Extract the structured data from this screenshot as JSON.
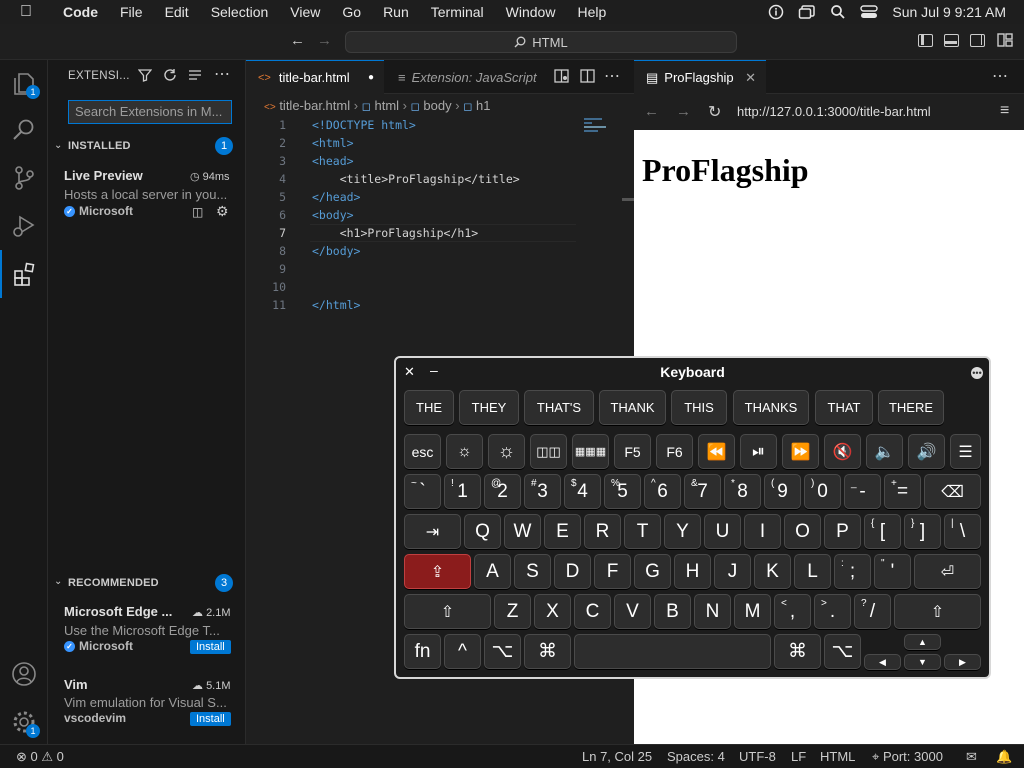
{
  "menubar": {
    "app": "Code",
    "items": [
      "File",
      "Edit",
      "Selection",
      "View",
      "Go",
      "Run",
      "Terminal",
      "Window",
      "Help"
    ],
    "datetime": "Sun Jul 9  9:21 AM"
  },
  "titlebar": {
    "command_center": "HTML"
  },
  "activity": {
    "explorer_badge": "1",
    "extensions_badge": "",
    "settings_badge": "1"
  },
  "sidebar": {
    "title": "EXTENSI...",
    "search_placeholder": "Search Extensions in M...",
    "installed": {
      "label": "INSTALLED",
      "count": "1",
      "items": [
        {
          "name": "Live Preview",
          "meta": "94ms",
          "desc": "Hosts a local server in you...",
          "publisher": "Microsoft"
        }
      ]
    },
    "recommended": {
      "label": "RECOMMENDED",
      "count": "3",
      "items": [
        {
          "name": "Microsoft Edge ...",
          "meta": "2.1M",
          "desc": "Use the Microsoft Edge T...",
          "publisher": "Microsoft",
          "action": "Install"
        },
        {
          "name": "Vim",
          "meta": "5.1M",
          "desc": "Vim emulation for Visual S...",
          "publisher": "vscodevim",
          "action": "Install"
        }
      ]
    }
  },
  "editor": {
    "tabs": [
      {
        "label": "title-bar.html",
        "active": true
      },
      {
        "label": "Extension: JavaScript",
        "active": false
      }
    ],
    "breadcrumb": [
      "title-bar.html",
      "html",
      "body",
      "h1"
    ],
    "lines": [
      {
        "n": "1",
        "text": "<!DOCTYPE html>"
      },
      {
        "n": "2",
        "text": "<html>"
      },
      {
        "n": "3",
        "text": "<head>"
      },
      {
        "n": "4",
        "text": "    <title>ProFlagship</title>"
      },
      {
        "n": "5",
        "text": "</head>"
      },
      {
        "n": "6",
        "text": "<body>"
      },
      {
        "n": "7",
        "text": "    <h1>ProFlagship</h1>"
      },
      {
        "n": "8",
        "text": "</body>"
      },
      {
        "n": "9",
        "text": ""
      },
      {
        "n": "10",
        "text": ""
      },
      {
        "n": "11",
        "text": "</html>"
      }
    ]
  },
  "browser": {
    "tab": "ProFlagship",
    "url": "http://127.0.0.1:3000/title-bar.html",
    "heading": "ProFlagship"
  },
  "status": {
    "errors": "0",
    "warnings": "0",
    "position": "Ln 7, Col 25",
    "spaces": "Spaces: 4",
    "encoding": "UTF-8",
    "eol": "LF",
    "language": "HTML",
    "port": "Port: 3000"
  },
  "keyboard": {
    "title": "Keyboard",
    "suggestions": [
      "THE",
      "THEY",
      "THAT'S",
      "THANK",
      "THIS",
      "THANKS",
      "THAT",
      "THERE"
    ],
    "fn_row": [
      "esc",
      "",
      "",
      "",
      "",
      "F5",
      "F6",
      "",
      "",
      "",
      "",
      "",
      "",
      ""
    ],
    "number_row": [
      {
        "sup": "~",
        "main": "`"
      },
      {
        "sup": "!",
        "main": "1"
      },
      {
        "sup": "@",
        "main": "2"
      },
      {
        "sup": "#",
        "main": "3"
      },
      {
        "sup": "$",
        "main": "4"
      },
      {
        "sup": "%",
        "main": "5"
      },
      {
        "sup": "^",
        "main": "6"
      },
      {
        "sup": "&",
        "main": "7"
      },
      {
        "sup": "*",
        "main": "8"
      },
      {
        "sup": "(",
        "main": "9"
      },
      {
        "sup": ")",
        "main": "0"
      },
      {
        "sup": "_",
        "main": "-"
      },
      {
        "sup": "+",
        "main": "="
      }
    ],
    "row_q": [
      "Q",
      "W",
      "E",
      "R",
      "T",
      "Y",
      "U",
      "I",
      "O",
      "P"
    ],
    "row_q_extra": [
      {
        "sup": "{",
        "main": "["
      },
      {
        "sup": "}",
        "main": "]"
      },
      {
        "sup": "|",
        "main": "\\"
      }
    ],
    "row_a": [
      "A",
      "S",
      "D",
      "F",
      "G",
      "H",
      "J",
      "K",
      "L"
    ],
    "row_a_extra": [
      {
        "sup": ":",
        "main": ";"
      },
      {
        "sup": "\"",
        "main": "'"
      }
    ],
    "row_z": [
      "Z",
      "X",
      "C",
      "V",
      "B",
      "N",
      "M"
    ],
    "row_z_extra": [
      {
        "sup": "<",
        "main": ","
      },
      {
        "sup": ">",
        "main": "."
      },
      {
        "sup": "?",
        "main": "/"
      }
    ],
    "bottom": {
      "fn": "fn",
      "ctrl": "^",
      "opt": "⌥",
      "cmd": "⌘"
    }
  },
  "colors": {
    "accent": "#0078d4",
    "shift_active": "#8b1c1c"
  }
}
